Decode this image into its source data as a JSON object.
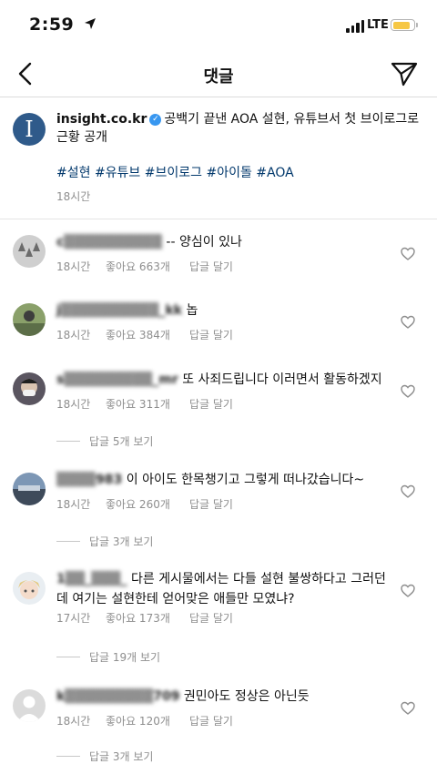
{
  "status_bar": {
    "time": "2:59",
    "network": "LTE",
    "battery_level": 0.85,
    "battery_color": "#f6c744"
  },
  "nav": {
    "title": "댓글"
  },
  "post": {
    "username": "insight.co.kr",
    "caption": "공백기 끝낸 AOA 설현, 유튜브서 첫 브이로그로 근황 공개",
    "hashtags": "#설현 #유튜브 #브이로그 #아이돌 #AOA",
    "time": "18시간",
    "avatar_letter": "I"
  },
  "comments": [
    {
      "username": "c▒▒▒▒▒▒▒▒▒▒",
      "text": "-- 양심이 있나",
      "time": "18시간",
      "likes": "좋아요 663개",
      "reply": "답글 달기",
      "replies_label": ""
    },
    {
      "username": "j▒▒▒▒▒▒▒▒▒▒_kk",
      "text": "놉",
      "time": "18시간",
      "likes": "좋아요 384개",
      "reply": "답글 달기",
      "replies_label": ""
    },
    {
      "username": "s▒▒▒▒▒▒▒▒▒_mr",
      "text": "또 사죄드립니다 이러면서 활동하겠지",
      "time": "18시간",
      "likes": "좋아요 311개",
      "reply": "답글 달기",
      "replies_label": "답글 5개 보기"
    },
    {
      "username": "▒▒▒▒983",
      "text": "이 아이도 한목챙기고 그렇게 떠나갔습니다~",
      "time": "18시간",
      "likes": "좋아요 260개",
      "reply": "답글 달기",
      "replies_label": "답글 3개 보기"
    },
    {
      "username": "1▒▒_▒▒▒_",
      "text": "다른 게시물에서는 다들 설현 불쌍하다고 그러던데 여기는 설현한테 얻어맞은 애들만 모였냐?",
      "time": "17시간",
      "likes": "좋아요 173개",
      "reply": "답글 달기",
      "replies_label": "답글 19개 보기"
    },
    {
      "username": "k▒▒▒▒▒▒▒▒▒709",
      "text": "권민아도 정상은 아닌듯",
      "time": "18시간",
      "likes": "좋아요 120개",
      "reply": "답글 달기",
      "replies_label": "답글 3개 보기"
    }
  ]
}
